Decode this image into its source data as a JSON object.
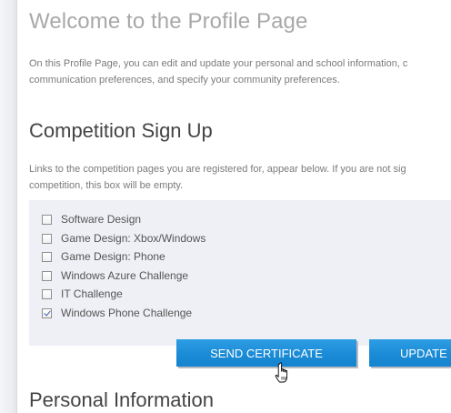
{
  "welcome": {
    "title": "Welcome to the Profile Page",
    "description_line1": "On this Profile Page, you can edit and update your personal and school information, c",
    "description_line2": "communication preferences, and specify your community preferences."
  },
  "competition": {
    "title": "Competition Sign Up",
    "description_line1": "Links to the competition pages you are registered for, appear below. If you are not sig",
    "description_line2": "competition, this box will be empty.",
    "items": [
      {
        "label": "Software Design",
        "checked": false
      },
      {
        "label": "Game Design: Xbox/Windows",
        "checked": false
      },
      {
        "label": "Game Design: Phone",
        "checked": false
      },
      {
        "label": "Windows Azure Challenge",
        "checked": false
      },
      {
        "label": "IT Challenge",
        "checked": false
      },
      {
        "label": "Windows Phone Challenge",
        "checked": true
      }
    ],
    "send_certificate_label": "SEND CERTIFICATE",
    "update_label": "UPDATE"
  },
  "personal": {
    "title": "Personal Information"
  },
  "colors": {
    "button": "#1a8bd6",
    "box_background": "#eef0f5",
    "heading_light": "#a8a8a8",
    "heading_dark": "#444444"
  },
  "icons": {
    "cursor": "hand-pointer-icon",
    "checkbox_checked": "checkmark-icon"
  }
}
